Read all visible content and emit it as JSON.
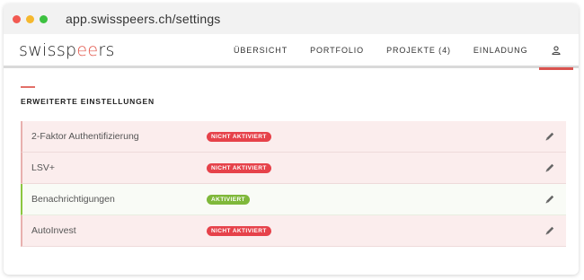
{
  "browser": {
    "url": "app.swisspeers.ch/settings"
  },
  "logo": {
    "text_start": "swissp",
    "text_accent": "ee",
    "text_end": "rs"
  },
  "nav": {
    "items": [
      {
        "label": "ÜBERSICHT"
      },
      {
        "label": "PORTFOLIO"
      },
      {
        "label": "PROJEKTE (4)"
      },
      {
        "label": "EINLADUNG"
      }
    ],
    "user_icon": "user-icon"
  },
  "section": {
    "title": "ERWEITERTE EINSTELLUNGEN"
  },
  "settings": [
    {
      "label": "2-Faktor Authentifizierung",
      "status": "NICHT AKTIVIERT",
      "active": false
    },
    {
      "label": "LSV+",
      "status": "NICHT AKTIVIERT",
      "active": false
    },
    {
      "label": "Benachrichtigungen",
      "status": "AKTIVIERT",
      "active": true
    },
    {
      "label": "AutoInvest",
      "status": "NICHT AKTIVIERT",
      "active": false
    }
  ],
  "colors": {
    "accent": "#e2594e",
    "inactive_badge": "#e6424a",
    "active_badge": "#7fb83a",
    "active_border": "#8cc63f"
  }
}
